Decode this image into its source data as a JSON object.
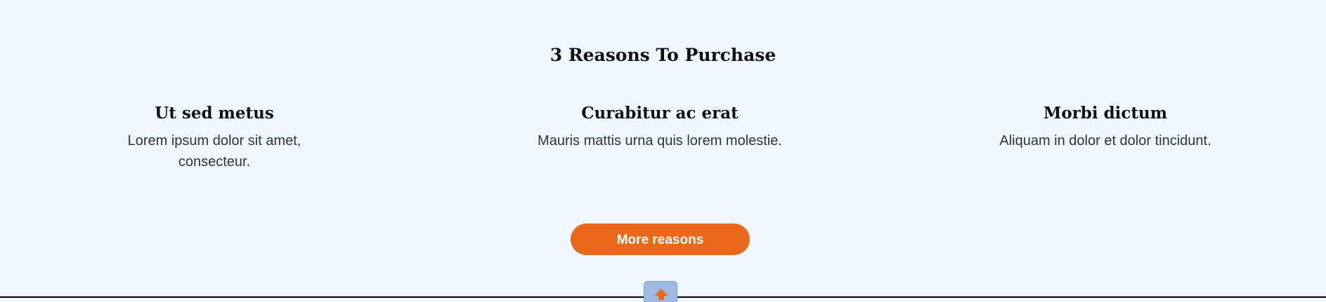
{
  "section": {
    "title": "3 Reasons To Purchase"
  },
  "reasons": [
    {
      "title": "Ut sed metus",
      "text": "Lorem ipsum dolor sit amet, consecteur."
    },
    {
      "title": "Curabitur ac erat",
      "text": "Mauris mattis urna quis lorem molestie."
    },
    {
      "title": "Morbi dictum",
      "text": "Aliquam in dolor et dolor tincidunt."
    }
  ],
  "cta": {
    "label": "More reasons"
  },
  "colors": {
    "background": "#f0f8ff",
    "accent": "#ec6819",
    "scroll_button": "#9fbbe4"
  },
  "icons": {
    "scroll_top": "arrow-up-icon"
  }
}
